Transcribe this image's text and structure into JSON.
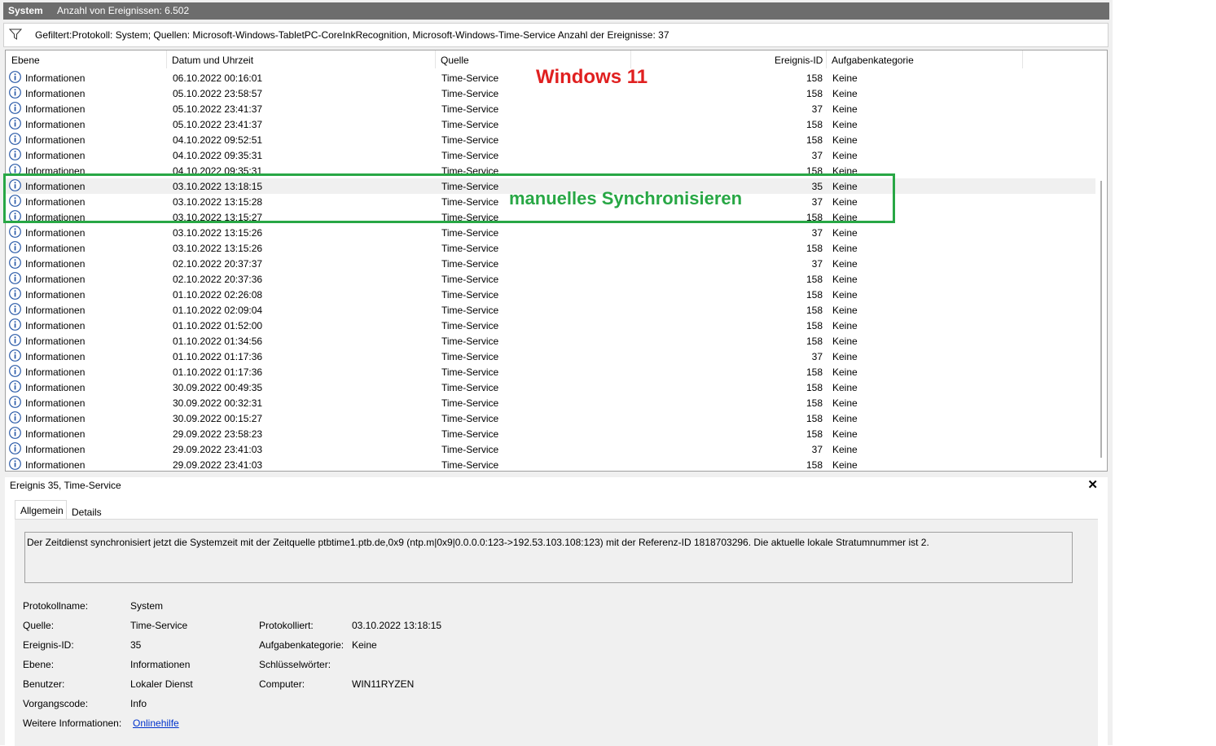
{
  "titlebar": {
    "title": "System",
    "count": "Anzahl von Ereignissen: 6.502"
  },
  "filter": {
    "text": "Gefiltert:Protokoll: System; Quellen: Microsoft-Windows-TabletPC-CoreInkRecognition, Microsoft-Windows-Time-Service Anzahl der Ereignisse: 37"
  },
  "columns": {
    "level": "Ebene",
    "date": "Datum und Uhrzeit",
    "source": "Quelle",
    "id": "Ereignis-ID",
    "category": "Aufgabenkategorie"
  },
  "events": [
    {
      "level": "Informationen",
      "date": "06.10.2022 00:16:01",
      "source": "Time-Service",
      "id": "158",
      "category": "Keine"
    },
    {
      "level": "Informationen",
      "date": "05.10.2022 23:58:57",
      "source": "Time-Service",
      "id": "158",
      "category": "Keine"
    },
    {
      "level": "Informationen",
      "date": "05.10.2022 23:41:37",
      "source": "Time-Service",
      "id": "37",
      "category": "Keine"
    },
    {
      "level": "Informationen",
      "date": "05.10.2022 23:41:37",
      "source": "Time-Service",
      "id": "158",
      "category": "Keine"
    },
    {
      "level": "Informationen",
      "date": "04.10.2022 09:52:51",
      "source": "Time-Service",
      "id": "158",
      "category": "Keine"
    },
    {
      "level": "Informationen",
      "date": "04.10.2022 09:35:31",
      "source": "Time-Service",
      "id": "37",
      "category": "Keine"
    },
    {
      "level": "Informationen",
      "date": "04.10.2022 09:35:31",
      "source": "Time-Service",
      "id": "158",
      "category": "Keine"
    },
    {
      "level": "Informationen",
      "date": "03.10.2022 13:18:15",
      "source": "Time-Service",
      "id": "35",
      "category": "Keine",
      "selected": true
    },
    {
      "level": "Informationen",
      "date": "03.10.2022 13:15:28",
      "source": "Time-Service",
      "id": "37",
      "category": "Keine"
    },
    {
      "level": "Informationen",
      "date": "03.10.2022 13:15:27",
      "source": "Time-Service",
      "id": "158",
      "category": "Keine"
    },
    {
      "level": "Informationen",
      "date": "03.10.2022 13:15:26",
      "source": "Time-Service",
      "id": "37",
      "category": "Keine"
    },
    {
      "level": "Informationen",
      "date": "03.10.2022 13:15:26",
      "source": "Time-Service",
      "id": "158",
      "category": "Keine"
    },
    {
      "level": "Informationen",
      "date": "02.10.2022 20:37:37",
      "source": "Time-Service",
      "id": "37",
      "category": "Keine"
    },
    {
      "level": "Informationen",
      "date": "02.10.2022 20:37:36",
      "source": "Time-Service",
      "id": "158",
      "category": "Keine"
    },
    {
      "level": "Informationen",
      "date": "01.10.2022 02:26:08",
      "source": "Time-Service",
      "id": "158",
      "category": "Keine"
    },
    {
      "level": "Informationen",
      "date": "01.10.2022 02:09:04",
      "source": "Time-Service",
      "id": "158",
      "category": "Keine"
    },
    {
      "level": "Informationen",
      "date": "01.10.2022 01:52:00",
      "source": "Time-Service",
      "id": "158",
      "category": "Keine"
    },
    {
      "level": "Informationen",
      "date": "01.10.2022 01:34:56",
      "source": "Time-Service",
      "id": "158",
      "category": "Keine"
    },
    {
      "level": "Informationen",
      "date": "01.10.2022 01:17:36",
      "source": "Time-Service",
      "id": "37",
      "category": "Keine"
    },
    {
      "level": "Informationen",
      "date": "01.10.2022 01:17:36",
      "source": "Time-Service",
      "id": "158",
      "category": "Keine"
    },
    {
      "level": "Informationen",
      "date": "30.09.2022 00:49:35",
      "source": "Time-Service",
      "id": "158",
      "category": "Keine"
    },
    {
      "level": "Informationen",
      "date": "30.09.2022 00:32:31",
      "source": "Time-Service",
      "id": "158",
      "category": "Keine"
    },
    {
      "level": "Informationen",
      "date": "30.09.2022 00:15:27",
      "source": "Time-Service",
      "id": "158",
      "category": "Keine"
    },
    {
      "level": "Informationen",
      "date": "29.09.2022 23:58:23",
      "source": "Time-Service",
      "id": "158",
      "category": "Keine"
    },
    {
      "level": "Informationen",
      "date": "29.09.2022 23:41:03",
      "source": "Time-Service",
      "id": "37",
      "category": "Keine"
    },
    {
      "level": "Informationen",
      "date": "29.09.2022 23:41:03",
      "source": "Time-Service",
      "id": "158",
      "category": "Keine"
    }
  ],
  "annotations": {
    "os_label": "Windows 11",
    "sync_label": "manuelles Synchronisieren",
    "os_color": "#e02020",
    "sync_color": "#28a745"
  },
  "detail": {
    "title": "Ereignis 35, Time-Service",
    "close": "✕",
    "tabs": {
      "general": "Allgemein",
      "details": "Details"
    },
    "description": "Der Zeitdienst synchronisiert jetzt die Systemzeit mit der Zeitquelle ptbtime1.ptb.de,0x9 (ntp.m|0x9|0.0.0.0:123->192.53.103.108:123) mit der Referenz-ID 1818703296. Die aktuelle lokale Stratumnummer ist 2.",
    "fields": {
      "log_name_label": "Protokollname:",
      "log_name": "System",
      "source_label": "Quelle:",
      "source": "Time-Service",
      "logged_label": "Protokolliert:",
      "logged": "03.10.2022 13:18:15",
      "event_id_label": "Ereignis-ID:",
      "event_id": "35",
      "task_category_label": "Aufgabenkategorie:",
      "task_category": "Keine",
      "level_label": "Ebene:",
      "level": "Informationen",
      "keywords_label": "Schlüsselwörter:",
      "user_label": "Benutzer:",
      "user": "Lokaler Dienst",
      "computer_label": "Computer:",
      "computer": "WIN11RYZEN",
      "opcode_label": "Vorgangscode:",
      "opcode": "Info",
      "more_info_label": "Weitere Informationen:",
      "more_info_link": "Onlinehilfe"
    }
  }
}
